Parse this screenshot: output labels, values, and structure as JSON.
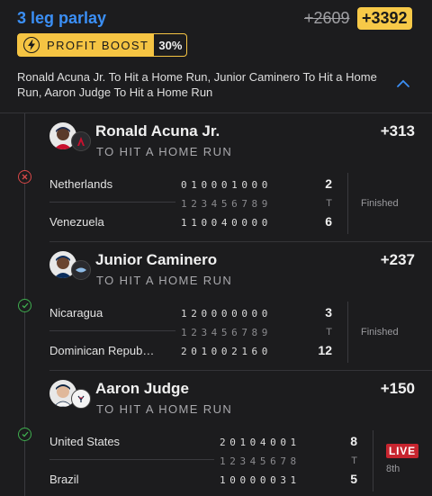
{
  "parlay": {
    "title": "3 leg parlay",
    "old_odds": "+2609",
    "new_odds": "+3392",
    "boost_label": "PROFIT BOOST",
    "boost_pct": "30%",
    "description": "Ronald Acuna Jr. To Hit a Home Run, Junior Caminero To Hit a Home Run, Aaron Judge To Hit a Home Run"
  },
  "legs": [
    {
      "player": "Ronald Acuna Jr.",
      "prop": "TO HIT A HOME RUN",
      "odds": "+313",
      "result": "lost",
      "team_logo": "braves-logo-icon",
      "away_team": "Netherlands",
      "away_innings": "010001000",
      "away_total": "2",
      "home_team": "Venezuela",
      "home_innings": "110040000",
      "home_total": "6",
      "inning_numbers": "123456789",
      "total_label": "T",
      "status": "Finished"
    },
    {
      "player": "Junior Caminero",
      "prop": "TO HIT A HOME RUN",
      "odds": "+237",
      "result": "won",
      "team_logo": "rays-logo-icon",
      "away_team": "Nicaragua",
      "away_innings": "120000000",
      "away_total": "3",
      "home_team": "Dominican Repub…",
      "home_innings": "201002160",
      "home_total": "12",
      "inning_numbers": "123456789",
      "total_label": "T",
      "status": "Finished"
    },
    {
      "player": "Aaron Judge",
      "prop": "TO HIT A HOME RUN",
      "odds": "+150",
      "result": "won",
      "team_logo": "yankees-logo-icon",
      "away_team": "United States",
      "away_innings": "20104001",
      "away_total": "8",
      "home_team": "Brazil",
      "home_innings": "10000031",
      "home_total": "5",
      "inning_numbers": "12345678",
      "total_label": "T",
      "live_label": "LIVE",
      "inning_label": "8th"
    }
  ],
  "colors": {
    "accent": "#3b8ff5",
    "boost": "#f5c443",
    "won": "#3fae4f",
    "lost": "#d94848",
    "live": "#c7252f"
  }
}
